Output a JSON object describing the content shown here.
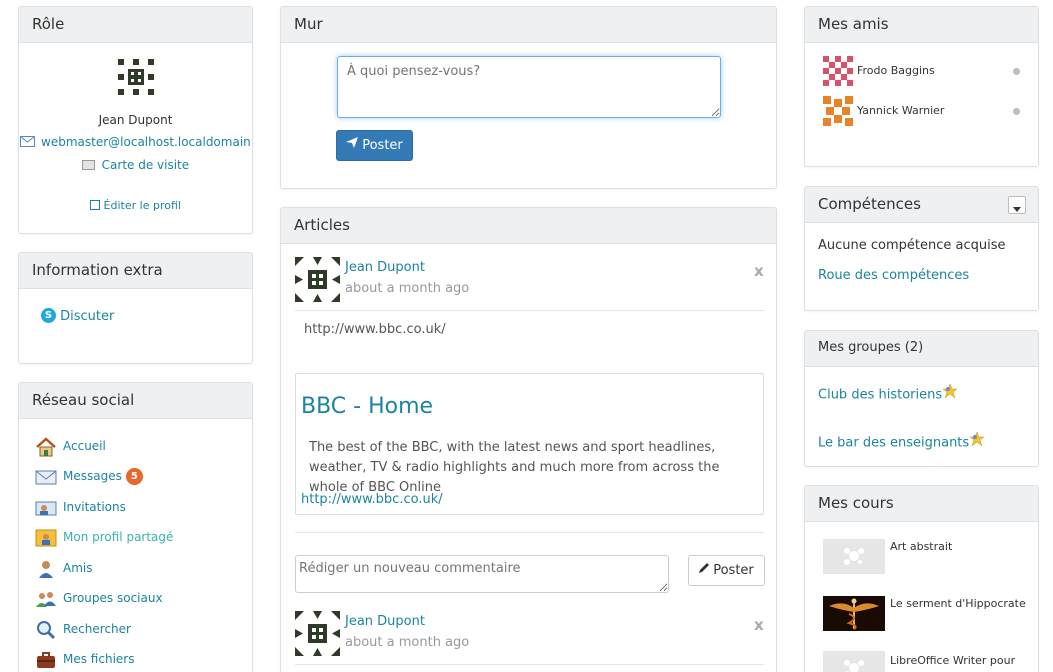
{
  "role": {
    "title": "Rôle",
    "user_name": "Jean Dupont",
    "email": "webmaster@localhost.localdomain",
    "business_card": "Carte de visite",
    "edit_profile": "Éditer le profil"
  },
  "extra": {
    "title": "Information extra",
    "chat": "Discuter"
  },
  "social": {
    "title": "Réseau social",
    "items": [
      {
        "label": "Accueil",
        "icon": "home-icon"
      },
      {
        "label": "Messages",
        "icon": "envelope-icon",
        "badge": "5"
      },
      {
        "label": "Invitations",
        "icon": "invitation-icon"
      },
      {
        "label": "Mon profil partagé",
        "icon": "shared-profile-icon"
      },
      {
        "label": "Amis",
        "icon": "friend-icon"
      },
      {
        "label": "Groupes sociaux",
        "icon": "groups-icon"
      },
      {
        "label": "Rechercher",
        "icon": "search-icon"
      },
      {
        "label": "Mes fichiers",
        "icon": "briefcase-icon"
      }
    ],
    "active_color": "#38b3b0"
  },
  "wall": {
    "title": "Mur",
    "placeholder": "À quoi pensez-vous?",
    "post_button": "Poster"
  },
  "articles": {
    "title": "Articles",
    "posts": [
      {
        "author": "Jean Dupont",
        "time": "about a month ago",
        "text": "http://www.bbc.co.uk/",
        "preview": {
          "title": "BBC - Home",
          "description": "The best of the BBC, with the latest news and sport headlines, weather, TV & radio highlights and much more from across the whole of BBC Online",
          "url": "http://www.bbc.co.uk/"
        },
        "comment_placeholder": "Rédiger un nouveau commentaire",
        "comment_button": "Poster"
      },
      {
        "author": "Jean Dupont",
        "time": "about a month ago"
      }
    ],
    "close_symbol": "x"
  },
  "friends": {
    "title": "Mes amis",
    "list": [
      {
        "name": "Frodo Baggins"
      },
      {
        "name": "Yannick Warnier"
      }
    ]
  },
  "skills": {
    "title": "Compétences",
    "none": "Aucune compétence acquise",
    "wheel": "Roue des compétences"
  },
  "groups": {
    "title": "Mes groupes (2)",
    "list": [
      {
        "name": "Club des historiens"
      },
      {
        "name": "Le bar des enseignants"
      }
    ]
  },
  "courses": {
    "title": "Mes cours",
    "list": [
      {
        "name": "Art abstrait"
      },
      {
        "name": "Le serment d'Hippocrate"
      },
      {
        "name": "LibreOffice Writer pour"
      }
    ]
  },
  "colors": {
    "link": "#1b84a0",
    "primary_button": "#337ab7",
    "badge": "#e8682a",
    "panel_header": "#eef0f1"
  }
}
